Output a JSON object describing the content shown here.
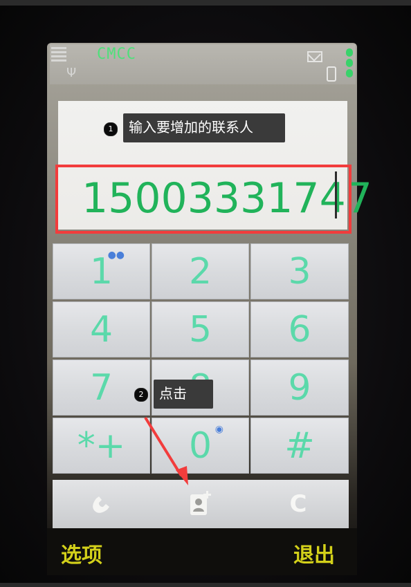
{
  "status_bar": {
    "carrier": "CMCC",
    "icons": [
      "signal-bars-icon",
      "antenna-icon",
      "mail-icon",
      "battery-icon",
      "level-dots-icon"
    ]
  },
  "dialer": {
    "number": "15003331747"
  },
  "keypad": {
    "keys": [
      {
        "label": "1",
        "sub_icon": "voicemail-icon"
      },
      {
        "label": "2"
      },
      {
        "label": "3"
      },
      {
        "label": "4"
      },
      {
        "label": "5"
      },
      {
        "label": "6"
      },
      {
        "label": "7"
      },
      {
        "label": "8"
      },
      {
        "label": "9"
      },
      {
        "label": "*+"
      },
      {
        "label": "0",
        "sub_icon": "globe-icon"
      },
      {
        "label": "#"
      }
    ]
  },
  "toolbar": {
    "call_icon": "phone-handset-icon",
    "add_contact_icon": "add-contact-icon",
    "clear_label": "C"
  },
  "softkeys": {
    "left": "选项",
    "right": "退出"
  },
  "annotations": {
    "step1_number": "1",
    "step1_text": "输入要增加的联系人",
    "step2_number": "2",
    "step2_text": "点击"
  },
  "colors": {
    "highlight_border": "#f23c3c",
    "number_text": "#21b35a",
    "softkey_text": "#d3d01a",
    "key_digit": "#55d9a8",
    "callout_bg": "#3a3a3a",
    "arrow": "#f23c3c"
  }
}
